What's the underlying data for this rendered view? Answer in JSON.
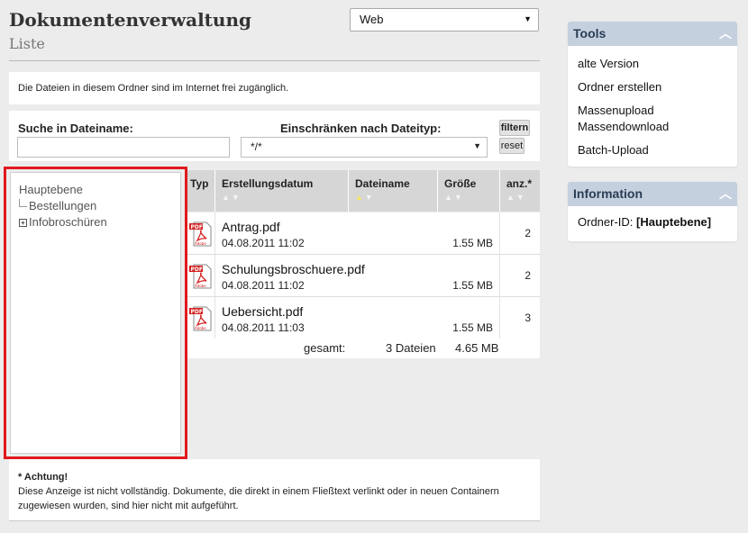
{
  "header": {
    "title": "Dokumentenverwaltung",
    "subtitle": "Liste",
    "context_select": "Web"
  },
  "info": {
    "text": "Die Dateien in diesem Ordner sind im Internet frei zugänglich."
  },
  "search": {
    "filename_label": "Suche in Dateiname:",
    "filename_value": "",
    "type_label": "Einschränken nach Dateityp:",
    "type_value": "*/*",
    "filter_button": "filtern",
    "reset_button": "reset"
  },
  "tree": {
    "root": "Hauptebene",
    "children": [
      "Bestellungen",
      "Infobroschüren"
    ]
  },
  "table": {
    "columns": [
      "Typ",
      "Erstellungsdatum",
      "Dateiname",
      "Größe",
      "anz.*"
    ],
    "sort_indicator": "▲▼",
    "rows": [
      {
        "name": "Antrag.pdf",
        "date": "04.08.2011 11:02",
        "size": "1.55 MB",
        "count": "2"
      },
      {
        "name": "Schulungsbroschuere.pdf",
        "date": "04.08.2011 11:02",
        "size": "1.55 MB",
        "count": "2"
      },
      {
        "name": "Uebersicht.pdf",
        "date": "04.08.2011 11:03",
        "size": "1.55 MB",
        "count": "3"
      }
    ],
    "total": {
      "label": "gesamt:",
      "files": "3 Dateien",
      "size": "4.65 MB"
    }
  },
  "note": {
    "title": "* Achtung!",
    "text": "Diese Anzeige ist nicht vollständig. Dokumente, die direkt in einem Fließtext verlinkt oder in neuen Containern zugewiesen wurden, sind hier nicht mit aufgeführt."
  },
  "tools": {
    "title": "Tools",
    "items": [
      "alte Version",
      "Ordner erstellen",
      "Massenupload",
      "Massendownload",
      "Batch-Upload"
    ]
  },
  "information": {
    "title": "Information",
    "label": "Ordner-ID:",
    "value": "[Hauptebene]"
  },
  "icons": {
    "select_arrow": "chevron-down-icon",
    "collapse": "chevron-up-icon",
    "expand": "plus-box-icon",
    "file_type": "pdf-icon"
  },
  "colors": {
    "panel_header": "#c4d0de",
    "highlight_border": "#e1191d",
    "pdf_red": "#d42020"
  }
}
